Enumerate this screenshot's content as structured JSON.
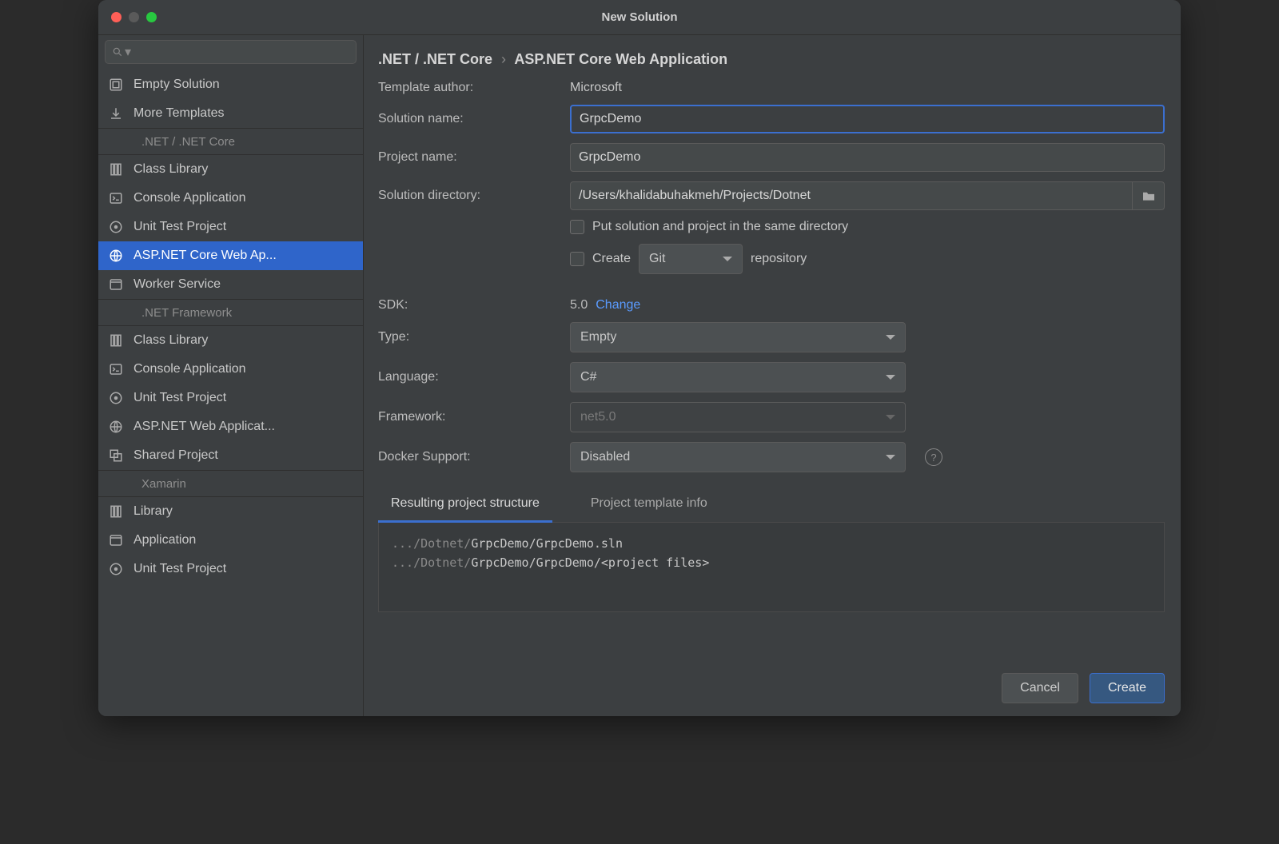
{
  "window": {
    "title": "New Solution"
  },
  "sidebar": {
    "items": [
      {
        "label": "Empty Solution",
        "icon": "empty-solution"
      },
      {
        "label": "More Templates",
        "icon": "download"
      }
    ],
    "groups": [
      {
        "header": ".NET / .NET Core",
        "items": [
          {
            "label": "Class Library",
            "icon": "library"
          },
          {
            "label": "Console Application",
            "icon": "console"
          },
          {
            "label": "Unit Test Project",
            "icon": "test"
          },
          {
            "label": "ASP.NET Core Web Ap...",
            "icon": "globe",
            "selected": true
          },
          {
            "label": "Worker Service",
            "icon": "window"
          }
        ]
      },
      {
        "header": ".NET Framework",
        "items": [
          {
            "label": "Class Library",
            "icon": "library"
          },
          {
            "label": "Console Application",
            "icon": "console"
          },
          {
            "label": "Unit Test Project",
            "icon": "test"
          },
          {
            "label": "ASP.NET Web Applicat...",
            "icon": "globe"
          },
          {
            "label": "Shared Project",
            "icon": "shared"
          }
        ]
      },
      {
        "header": "Xamarin",
        "items": [
          {
            "label": "Library",
            "icon": "library"
          },
          {
            "label": "Application",
            "icon": "window"
          },
          {
            "label": "Unit Test Project",
            "icon": "test"
          }
        ]
      }
    ]
  },
  "breadcrumb": {
    "group": ".NET / .NET Core",
    "template": "ASP.NET Core Web Application"
  },
  "form": {
    "author_label": "Template author:",
    "author_value": "Microsoft",
    "solution_label": "Solution name:",
    "solution_value": "GrpcDemo",
    "project_label": "Project name:",
    "project_value": "GrpcDemo",
    "directory_label": "Solution directory:",
    "directory_value": "/Users/khalidabuhakmeh/Projects/Dotnet",
    "same_dir_label": "Put solution and project in the same directory",
    "create_repo_label_pre": "Create",
    "create_repo_vcs": "Git",
    "create_repo_label_post": "repository",
    "sdk_label": "SDK:",
    "sdk_value": "5.0",
    "sdk_change": "Change",
    "type_label": "Type:",
    "type_value": "Empty",
    "language_label": "Language:",
    "language_value": "C#",
    "framework_label": "Framework:",
    "framework_value": "net5.0",
    "docker_label": "Docker Support:",
    "docker_value": "Disabled"
  },
  "tabs": {
    "structure": "Resulting project structure",
    "info": "Project template info"
  },
  "structure": {
    "line1_pre": ".../Dotnet/",
    "line1_hl": "GrpcDemo/GrpcDemo.sln",
    "line2_pre": ".../Dotnet/",
    "line2_hl": "GrpcDemo/GrpcDemo/<project files>"
  },
  "footer": {
    "cancel": "Cancel",
    "create": "Create"
  }
}
